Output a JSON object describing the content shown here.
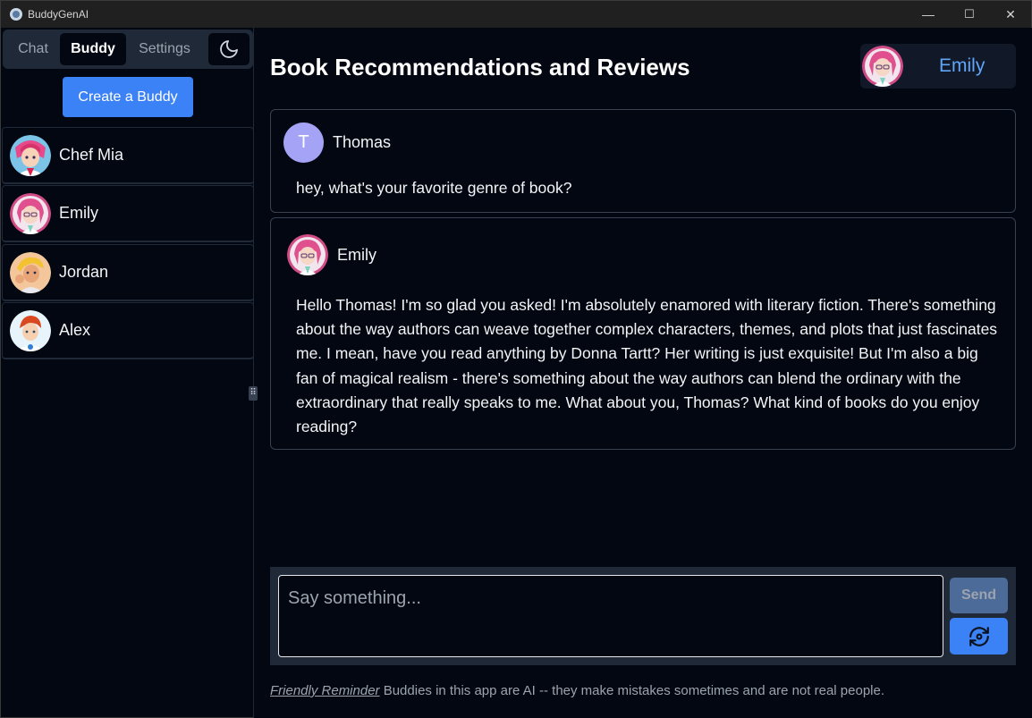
{
  "window": {
    "title": "BuddyGenAI",
    "minimize_icon": "—",
    "maximize_icon": "☐",
    "close_icon": "✕"
  },
  "nav": {
    "tabs": [
      {
        "label": "Chat",
        "active": false
      },
      {
        "label": "Buddy",
        "active": true
      },
      {
        "label": "Settings",
        "active": false
      }
    ],
    "theme_icon": "moon-icon"
  },
  "sidebar": {
    "create_label": "Create a Buddy",
    "buddies": [
      {
        "name": "Chef Mia"
      },
      {
        "name": "Emily"
      },
      {
        "name": "Jordan"
      },
      {
        "name": "Alex"
      }
    ]
  },
  "header": {
    "title": "Book Recommendations and Reviews",
    "active_buddy": "Emily"
  },
  "messages": [
    {
      "author": "Thomas",
      "initial": "T",
      "text": "hey, what's your favorite genre of book?"
    },
    {
      "author": "Emily",
      "text": "Hello Thomas! I'm so glad you asked! I'm absolutely enamored with literary fiction. There's something about the way authors can weave together complex characters, themes, and plots that just fascinates me. I mean, have you read anything by Donna Tartt? Her writing is just exquisite! But I'm also a big fan of magical realism - there's something about the way authors can blend the ordinary with the extraordinary that really speaks to me. What about you, Thomas? What kind of books do you enjoy reading?"
    }
  ],
  "composer": {
    "placeholder": "Say something...",
    "send_label": "Send",
    "regenerate_icon": "refresh-icon"
  },
  "footer": {
    "link_text": "Friendly Reminder",
    "text": " Buddies in this app are AI -- they make mistakes sometimes and are not real people."
  },
  "colors": {
    "accent": "#3b82f6",
    "background": "#030712",
    "panel": "#1f2937"
  }
}
